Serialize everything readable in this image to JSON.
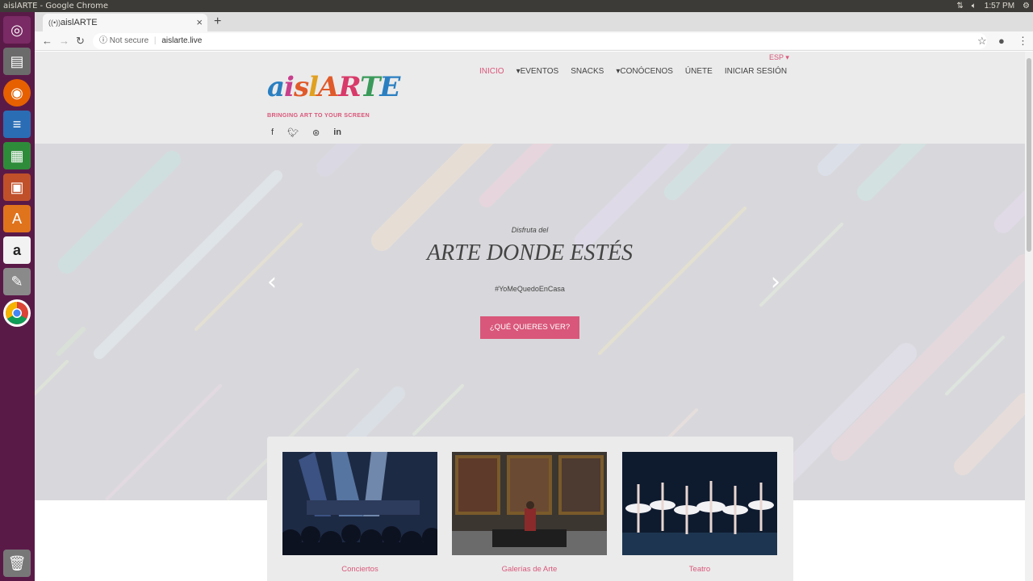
{
  "os": {
    "window_title": "aislARTE - Google Chrome",
    "time": "1:57 PM"
  },
  "launcher": {
    "icons": [
      "ubuntu-dash-icon",
      "files-icon",
      "firefox-icon",
      "writer-icon",
      "calc-icon",
      "impress-icon",
      "software-center-icon",
      "amazon-icon",
      "settings-icon",
      "chrome-icon",
      "trash-icon"
    ]
  },
  "browser": {
    "tab_title": "aislARTE",
    "security_label": "Not secure",
    "url": "aislarte.live"
  },
  "site": {
    "lang": "ESP",
    "nav": [
      {
        "label": "INICIO"
      },
      {
        "label": "EVENTOS"
      },
      {
        "label": "SNACKS"
      },
      {
        "label": "CONÓCENOS"
      },
      {
        "label": "ÚNETE"
      },
      {
        "label": "INICIAR SESIÓN"
      }
    ],
    "logo": {
      "word": "aislARTE",
      "tagline": "BRINGING ART TO YOUR SCREEN"
    },
    "hero": {
      "kicker": "Disfruta del",
      "title": "ARTE DONDE ESTÉS",
      "hashtag": "#YoMeQuedoEnCasa",
      "cta": "¿QUÉ QUIERES VER?"
    },
    "cards": [
      {
        "caption": "Conciertos"
      },
      {
        "caption": "Galerías de Arte"
      },
      {
        "caption": "Teatro"
      }
    ]
  },
  "colors": {
    "accent": "#d9577a",
    "launcher": "#5a1a48",
    "os_bar": "#3c3b37"
  }
}
